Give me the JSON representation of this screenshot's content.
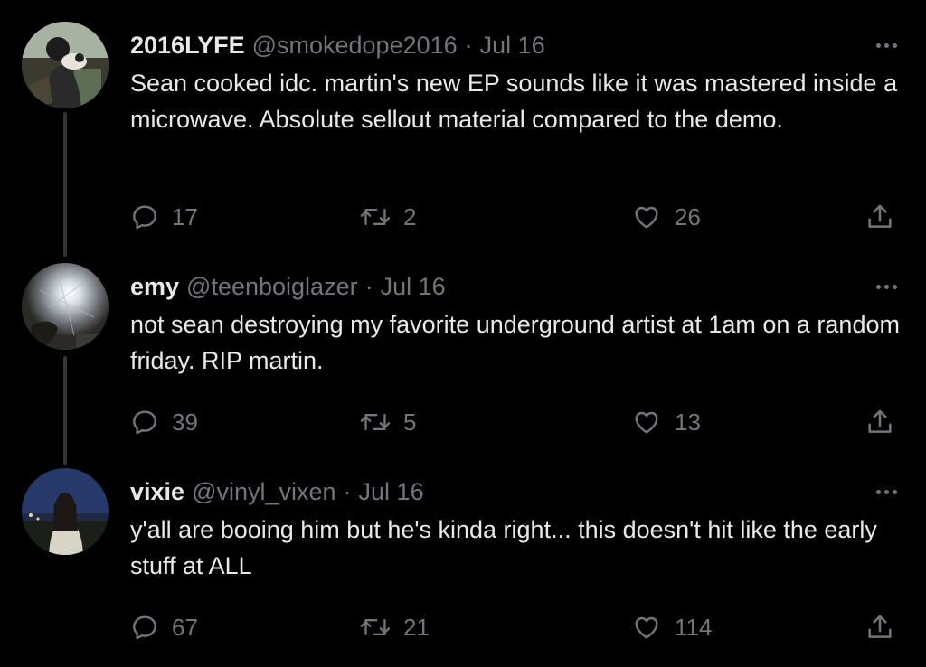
{
  "tweets": [
    {
      "name": "2016LYFE",
      "handle": "@smokedope2016",
      "separator": "·",
      "date": "Jul 16",
      "text": "Sean cooked idc. martin's new EP sounds like it was mastered inside a microwave. Absolute sellout material compared to the demo.",
      "replies": "17",
      "retweets": "2",
      "likes": "26"
    },
    {
      "name": "emy",
      "handle": "@teenboiglazer",
      "separator": "·",
      "date": "Jul 16",
      "text": "not sean destroying my favorite underground artist at 1am on a random friday. RIP martin.",
      "replies": "39",
      "retweets": "5",
      "likes": "13"
    },
    {
      "name": "vixie",
      "handle": "@vinyl_vixen",
      "separator": "·",
      "date": "Jul 16",
      "text": "y'all are booing him but he's kinda right... this doesn't hit like the early stuff at ALL",
      "replies": "67",
      "retweets": "21",
      "likes": "114"
    }
  ],
  "icons": {
    "reply": "reply-icon",
    "retweet": "retweet-icon",
    "like": "heart-icon",
    "share": "share-icon",
    "more": "more-icon"
  },
  "colors": {
    "background": "#000000",
    "text": "#e7e9ea",
    "secondary": "#71767b",
    "thread_line": "#333639"
  }
}
